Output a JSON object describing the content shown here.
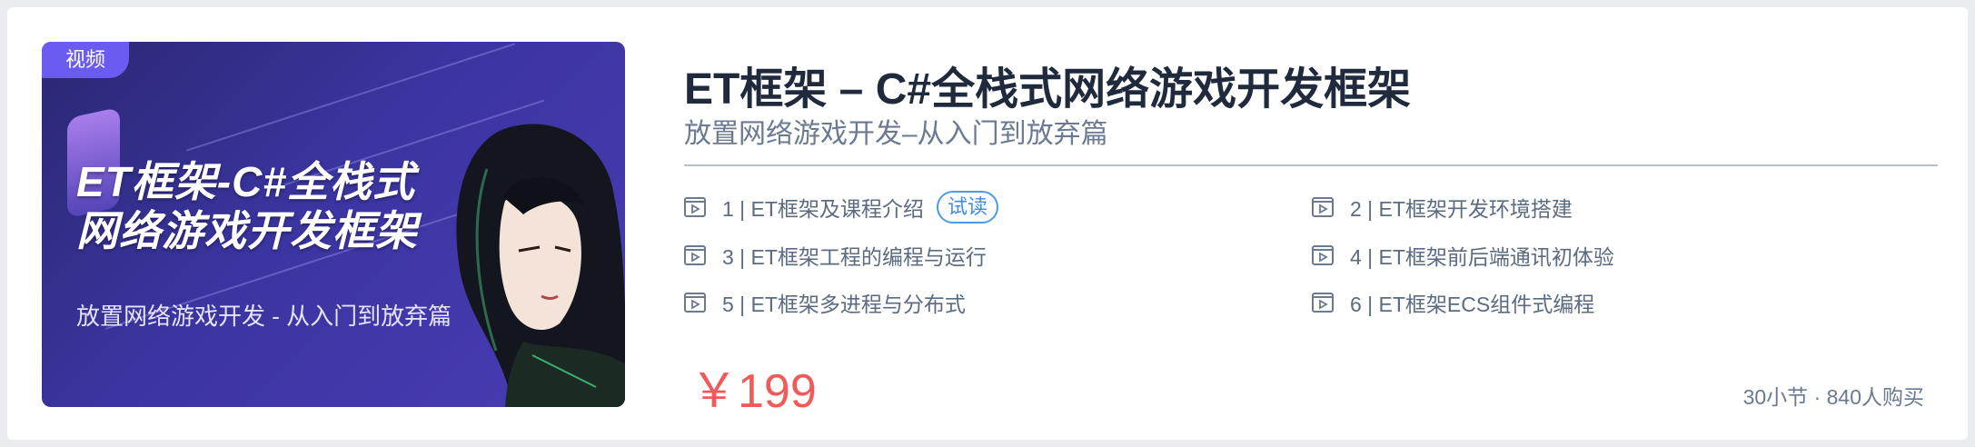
{
  "course": {
    "badge": "视频",
    "cover_title_line1": "ET框架-C#全栈式",
    "cover_title_line2": "网络游戏开发框架",
    "cover_subtitle": "放置网络游戏开发 - 从入门到放弃篇",
    "title": "ET框架 – C#全栈式网络游戏开发框架",
    "subtitle": "放置网络游戏开发–从入门到放弃篇",
    "price": "￥199",
    "meta": "30小节 · 840人购买"
  },
  "lessons": [
    {
      "label": "1 | ET框架及课程介绍",
      "tag": "试读"
    },
    {
      "label": "2 | ET框架开发环境搭建"
    },
    {
      "label": "3 | ET框架工程的编程与运行"
    },
    {
      "label": "4 | ET框架前后端通讯初体验"
    },
    {
      "label": "5 | ET框架多进程与分布式"
    },
    {
      "label": "6 | ET框架ECS组件式编程"
    }
  ],
  "icons": {
    "lesson": "video-play-icon"
  },
  "colors": {
    "price": "#f25a5a",
    "trial_tag": "#3d8ee8",
    "title": "#1f2a3d",
    "cover_bg": "#3a35a0",
    "badge_bg": "#6a5cf0"
  }
}
